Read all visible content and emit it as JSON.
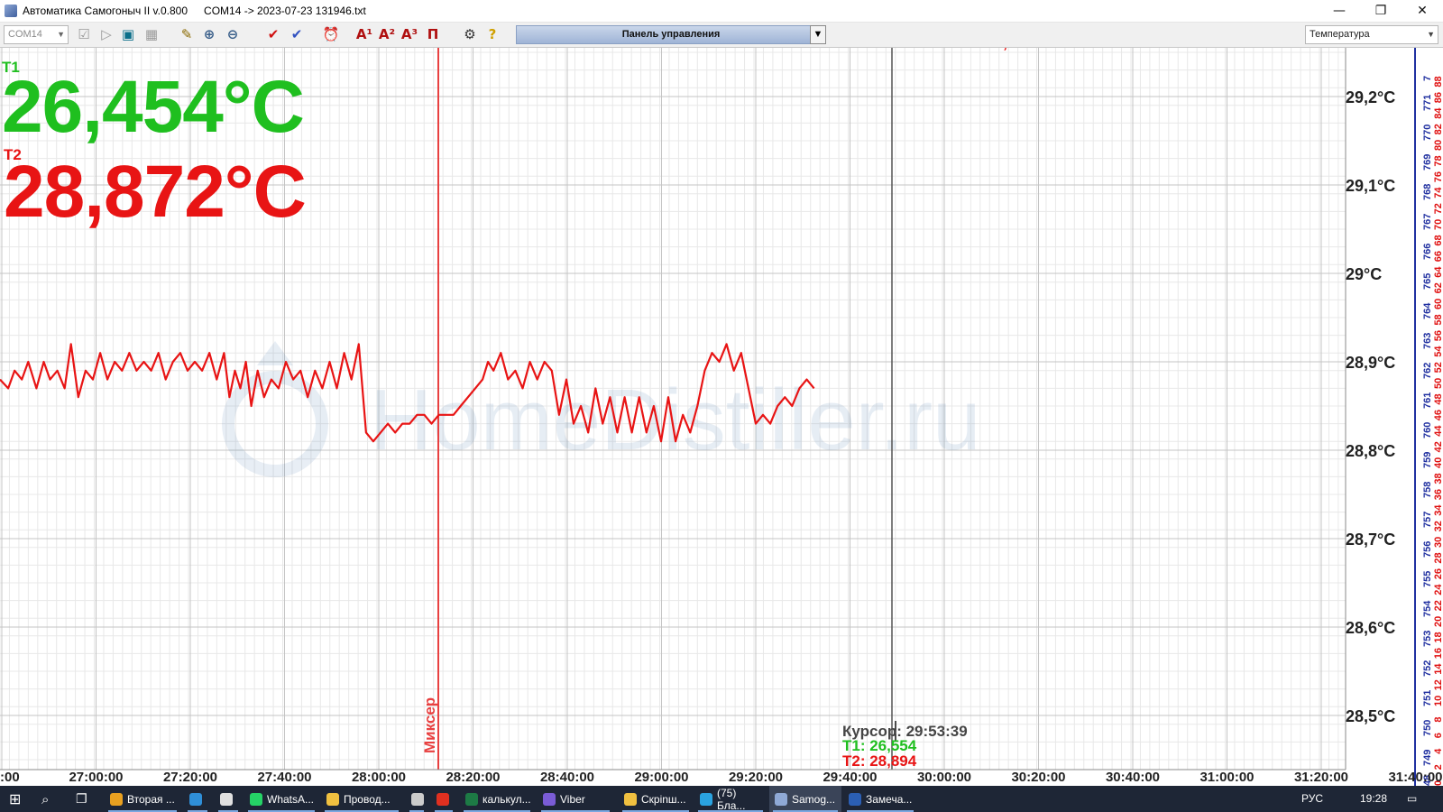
{
  "window": {
    "title": "Автоматика Самогоныч II v.0.800",
    "file": "COM14 -> 2023-07-23 131946.txt",
    "minimize": "—",
    "maximize": "❐",
    "close": "✕"
  },
  "toolbar": {
    "port": "COM14",
    "panel_label": "Панель управления",
    "view_select": "Температура",
    "buttons": [
      {
        "name": "checkbox-icon",
        "glyph": "☑",
        "color": "#9a9a9a"
      },
      {
        "name": "step-icon",
        "glyph": "▷",
        "color": "#9a9a9a"
      },
      {
        "name": "stop-icon",
        "glyph": "▣",
        "color": "#0b6f8a"
      },
      {
        "name": "grid-icon",
        "glyph": "▦",
        "color": "#9a9a9a"
      },
      {
        "name": "open-file-icon",
        "glyph": "✎",
        "color": "#8a6a00"
      },
      {
        "name": "zoom-in-icon",
        "glyph": "⊕",
        "color": "#3a5f8a"
      },
      {
        "name": "zoom-out-icon",
        "glyph": "⊖",
        "color": "#3a5f8a"
      },
      {
        "name": "check-red-icon",
        "glyph": "✔",
        "color": "#d01010"
      },
      {
        "name": "check-blue-icon",
        "glyph": "✔",
        "color": "#3050c0"
      },
      {
        "name": "alarm-clock-icon",
        "glyph": "⏰",
        "color": "#8a1010"
      },
      {
        "name": "a1-icon",
        "glyph": "A¹",
        "color": "#b01010"
      },
      {
        "name": "a2-icon",
        "glyph": "A²",
        "color": "#b01010"
      },
      {
        "name": "a3-icon",
        "glyph": "A³",
        "color": "#b01010"
      },
      {
        "name": "pi-icon",
        "glyph": "П",
        "color": "#b01010"
      },
      {
        "name": "settings-icon",
        "glyph": "⚙",
        "color": "#333333"
      },
      {
        "name": "help-icon",
        "glyph": "?",
        "color": "#d0a000"
      }
    ]
  },
  "readings": {
    "t1_tag": "T1",
    "t1_value": "26,454°C",
    "t2_tag": "T2",
    "t2_value": "28,872°C",
    "t1_color": "#1fbf1f",
    "t2_color": "#e81414"
  },
  "chart_data": {
    "type": "line",
    "ylim": [
      28.45,
      29.25
    ],
    "y_tick_values": [
      29.2,
      29.1,
      29.0,
      28.9,
      28.8,
      28.7,
      28.6,
      28.5
    ],
    "y_tick_labels": [
      "29,2°C",
      "29,1°C",
      "29°C",
      "28,9°C",
      "28,8°C",
      "28,7°C",
      "28,6°C",
      "28,5°C"
    ],
    "x_tick_labels": [
      ":00",
      "27:00:00",
      "27:20:00",
      "27:40:00",
      "28:00:00",
      "28:20:00",
      "28:40:00",
      "29:00:00",
      "29:20:00",
      "29:40:00",
      "30:00:00",
      "30:20:00",
      "30:40:00",
      "31:00:00",
      "31:20:00",
      "31:40:00"
    ],
    "marker_label": "Миксер",
    "marker_time": "28:17:00",
    "cursor_time_value": "29:53:39",
    "end_label": "T2: 28,872",
    "series": [
      {
        "color": "#e81414",
        "x_minutes": [
          0,
          0.9,
          1.6,
          2.4,
          3.1,
          4.0,
          4.8,
          5.5,
          6.3,
          7.1,
          7.8,
          8.6,
          9.4,
          10.2,
          11.0,
          11.8,
          12.6,
          13.4,
          14.2,
          15.0,
          15.8,
          16.6,
          17.4,
          18.2,
          19.0,
          19.8,
          20.6,
          21.4,
          22.2,
          23.0,
          23.8,
          24.6,
          25.2,
          25.8,
          26.4,
          27.0,
          27.6,
          28.3,
          29.0,
          29.8,
          30.6,
          31.4,
          32.2,
          33.0,
          33.8,
          34.6,
          35.4,
          36.2,
          37.0,
          37.8,
          38.6,
          39.4,
          40.2,
          41.0,
          41.8,
          42.6,
          43.4,
          44.2,
          45.0,
          45.8,
          46.6,
          47.4,
          48.2,
          49.0,
          49.8,
          50.6,
          51.4,
          52.2,
          53.0,
          53.6,
          54.2,
          55.0,
          55.8,
          56.6,
          57.4,
          58.2,
          59.0,
          59.8,
          60.6,
          61.4,
          62.2,
          63.0,
          63.8,
          64.6,
          65.4,
          66.2,
          67.0,
          67.8,
          68.6,
          69.4,
          70.2,
          71.0,
          71.8,
          72.6,
          73.4,
          74.2,
          75.0,
          75.8,
          76.6,
          77.4,
          78.2,
          79.0,
          79.8,
          80.6,
          81.4,
          82.2,
          83.0,
          83.8,
          84.6,
          85.4,
          86.2,
          87.0,
          87.8,
          88.6,
          89.4,
          90.2,
          91.0,
          91.8,
          92.6,
          93.4,
          94.2,
          95.0,
          95.8,
          96.6,
          97.4,
          98.2,
          99.0,
          99.8,
          100.6,
          101.4,
          102.2,
          103.0,
          103.8,
          104.4
        ],
        "values": [
          28.88,
          28.87,
          28.89,
          28.88,
          28.9,
          28.87,
          28.9,
          28.88,
          28.89,
          28.87,
          28.92,
          28.86,
          28.89,
          28.88,
          28.91,
          28.88,
          28.9,
          28.89,
          28.91,
          28.89,
          28.9,
          28.89,
          28.91,
          28.88,
          28.9,
          28.91,
          28.89,
          28.9,
          28.89,
          28.91,
          28.88,
          28.91,
          28.86,
          28.89,
          28.87,
          28.9,
          28.85,
          28.89,
          28.86,
          28.88,
          28.87,
          28.9,
          28.88,
          28.89,
          28.86,
          28.89,
          28.87,
          28.9,
          28.87,
          28.91,
          28.88,
          28.92,
          28.82,
          28.81,
          28.82,
          28.83,
          28.82,
          28.83,
          28.83,
          28.84,
          28.84,
          28.83,
          28.84,
          28.84,
          28.84,
          28.85,
          28.86,
          28.87,
          28.88,
          28.9,
          28.89,
          28.91,
          28.88,
          28.89,
          28.87,
          28.9,
          28.88,
          28.9,
          28.89,
          28.84,
          28.88,
          28.83,
          28.85,
          28.82,
          28.87,
          28.83,
          28.86,
          28.82,
          28.86,
          28.82,
          28.86,
          28.82,
          28.85,
          28.81,
          28.86,
          28.81,
          28.84,
          28.82,
          28.85,
          28.89,
          28.91,
          28.9,
          28.92,
          28.89,
          28.91,
          28.87,
          28.83,
          28.84,
          28.83,
          28.85,
          28.86,
          28.85,
          28.87,
          28.88,
          28.87
        ]
      }
    ],
    "right_scale_blue": [
      "749",
      "750",
      "751",
      "752",
      "753",
      "754",
      "755",
      "756",
      "757",
      "758",
      "759",
      "760",
      "761",
      "762",
      "763",
      "764",
      "765",
      "766",
      "767",
      "768",
      "769",
      "770",
      "771",
      "7"
    ],
    "right_scale_red": [
      "0",
      "2",
      "4",
      "6",
      "8",
      "10",
      "12",
      "14",
      "16",
      "18",
      "20",
      "22",
      "24",
      "26",
      "28",
      "30",
      "32",
      "34",
      "36",
      "38",
      "40",
      "42",
      "44",
      "46",
      "48",
      "50",
      "52",
      "54",
      "56",
      "58",
      "60",
      "62",
      "64",
      "66",
      "68",
      "70",
      "72",
      "74",
      "76",
      "78",
      "80",
      "82",
      "84",
      "86",
      "88"
    ],
    "right_scale_blue_bottom": "48"
  },
  "watermark": "HomeDistiller.ru",
  "cursor": {
    "time": "Курсор: 29:53:39",
    "t1": "T1: 26,554",
    "t2": "T2: 28,894"
  },
  "taskbar": {
    "items": [
      {
        "label": "Вторая ...",
        "name": "chrome",
        "color": "#e8a020"
      },
      {
        "label": "",
        "name": "edge",
        "color": "#2f8fd8"
      },
      {
        "label": "",
        "name": "yandex-browser",
        "color": "#e0e0e0"
      },
      {
        "label": "WhatsA...",
        "name": "whatsapp",
        "color": "#25d366"
      },
      {
        "label": "Провод...",
        "name": "explorer",
        "color": "#f0c040"
      },
      {
        "label": "",
        "name": "settings",
        "color": "#cccccc"
      },
      {
        "label": "",
        "name": "yandex",
        "color": "#e03020"
      },
      {
        "label": "калькул...",
        "name": "excel",
        "color": "#1d7a45"
      },
      {
        "label": "Viber",
        "name": "viber",
        "color": "#7a5cd6"
      },
      {
        "label": "Скрinш...",
        "name": "screenshots-folder",
        "color": "#f0c040"
      },
      {
        "label": "(75) Бла...",
        "name": "telegram",
        "color": "#2aa3e0"
      },
      {
        "label": "Samog...",
        "name": "samogonych",
        "color": "#8fa9d6"
      },
      {
        "label": "Замеча...",
        "name": "word",
        "color": "#2b5fb4"
      }
    ],
    "lang": "РУС",
    "time": "19:28"
  }
}
